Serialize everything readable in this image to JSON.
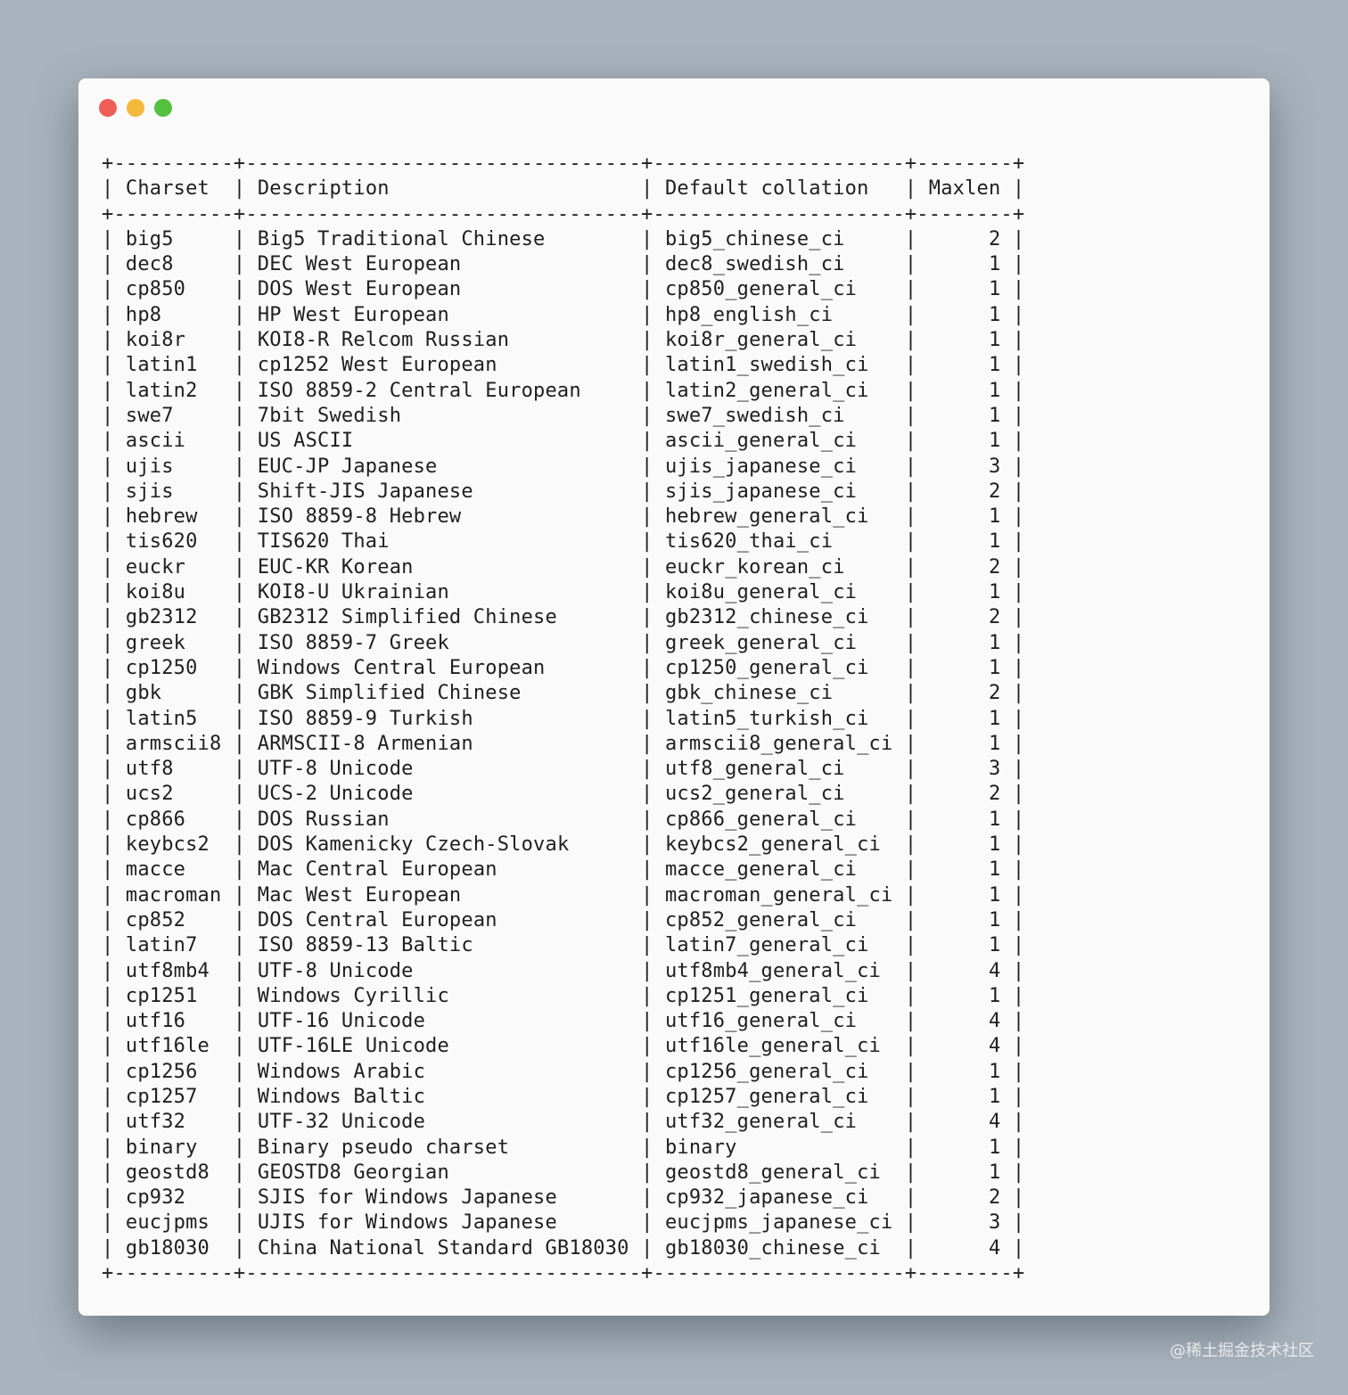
{
  "window": {
    "buttons": {
      "close_color": "#ee5e57",
      "minimize_color": "#f4b93a",
      "maximize_color": "#54c040"
    }
  },
  "table": {
    "columns": [
      "Charset",
      "Description",
      "Default collation",
      "Maxlen"
    ],
    "rows": [
      [
        "big5",
        "Big5 Traditional Chinese",
        "big5_chinese_ci",
        "2"
      ],
      [
        "dec8",
        "DEC West European",
        "dec8_swedish_ci",
        "1"
      ],
      [
        "cp850",
        "DOS West European",
        "cp850_general_ci",
        "1"
      ],
      [
        "hp8",
        "HP West European",
        "hp8_english_ci",
        "1"
      ],
      [
        "koi8r",
        "KOI8-R Relcom Russian",
        "koi8r_general_ci",
        "1"
      ],
      [
        "latin1",
        "cp1252 West European",
        "latin1_swedish_ci",
        "1"
      ],
      [
        "latin2",
        "ISO 8859-2 Central European",
        "latin2_general_ci",
        "1"
      ],
      [
        "swe7",
        "7bit Swedish",
        "swe7_swedish_ci",
        "1"
      ],
      [
        "ascii",
        "US ASCII",
        "ascii_general_ci",
        "1"
      ],
      [
        "ujis",
        "EUC-JP Japanese",
        "ujis_japanese_ci",
        "3"
      ],
      [
        "sjis",
        "Shift-JIS Japanese",
        "sjis_japanese_ci",
        "2"
      ],
      [
        "hebrew",
        "ISO 8859-8 Hebrew",
        "hebrew_general_ci",
        "1"
      ],
      [
        "tis620",
        "TIS620 Thai",
        "tis620_thai_ci",
        "1"
      ],
      [
        "euckr",
        "EUC-KR Korean",
        "euckr_korean_ci",
        "2"
      ],
      [
        "koi8u",
        "KOI8-U Ukrainian",
        "koi8u_general_ci",
        "1"
      ],
      [
        "gb2312",
        "GB2312 Simplified Chinese",
        "gb2312_chinese_ci",
        "2"
      ],
      [
        "greek",
        "ISO 8859-7 Greek",
        "greek_general_ci",
        "1"
      ],
      [
        "cp1250",
        "Windows Central European",
        "cp1250_general_ci",
        "1"
      ],
      [
        "gbk",
        "GBK Simplified Chinese",
        "gbk_chinese_ci",
        "2"
      ],
      [
        "latin5",
        "ISO 8859-9 Turkish",
        "latin5_turkish_ci",
        "1"
      ],
      [
        "armscii8",
        "ARMSCII-8 Armenian",
        "armscii8_general_ci",
        "1"
      ],
      [
        "utf8",
        "UTF-8 Unicode",
        "utf8_general_ci",
        "3"
      ],
      [
        "ucs2",
        "UCS-2 Unicode",
        "ucs2_general_ci",
        "2"
      ],
      [
        "cp866",
        "DOS Russian",
        "cp866_general_ci",
        "1"
      ],
      [
        "keybcs2",
        "DOS Kamenicky Czech-Slovak",
        "keybcs2_general_ci",
        "1"
      ],
      [
        "macce",
        "Mac Central European",
        "macce_general_ci",
        "1"
      ],
      [
        "macroman",
        "Mac West European",
        "macroman_general_ci",
        "1"
      ],
      [
        "cp852",
        "DOS Central European",
        "cp852_general_ci",
        "1"
      ],
      [
        "latin7",
        "ISO 8859-13 Baltic",
        "latin7_general_ci",
        "1"
      ],
      [
        "utf8mb4",
        "UTF-8 Unicode",
        "utf8mb4_general_ci",
        "4"
      ],
      [
        "cp1251",
        "Windows Cyrillic",
        "cp1251_general_ci",
        "1"
      ],
      [
        "utf16",
        "UTF-16 Unicode",
        "utf16_general_ci",
        "4"
      ],
      [
        "utf16le",
        "UTF-16LE Unicode",
        "utf16le_general_ci",
        "4"
      ],
      [
        "cp1256",
        "Windows Arabic",
        "cp1256_general_ci",
        "1"
      ],
      [
        "cp1257",
        "Windows Baltic",
        "cp1257_general_ci",
        "1"
      ],
      [
        "utf32",
        "UTF-32 Unicode",
        "utf32_general_ci",
        "4"
      ],
      [
        "binary",
        "Binary pseudo charset",
        "binary",
        "1"
      ],
      [
        "geostd8",
        "GEOSTD8 Georgian",
        "geostd8_general_ci",
        "1"
      ],
      [
        "cp932",
        "SJIS for Windows Japanese",
        "cp932_japanese_ci",
        "2"
      ],
      [
        "eucjpms",
        "UJIS for Windows Japanese",
        "eucjpms_japanese_ci",
        "3"
      ],
      [
        "gb18030",
        "China National Standard GB18030",
        "gb18030_chinese_ci",
        "4"
      ]
    ]
  },
  "watermark": "@稀土掘金技术社区"
}
